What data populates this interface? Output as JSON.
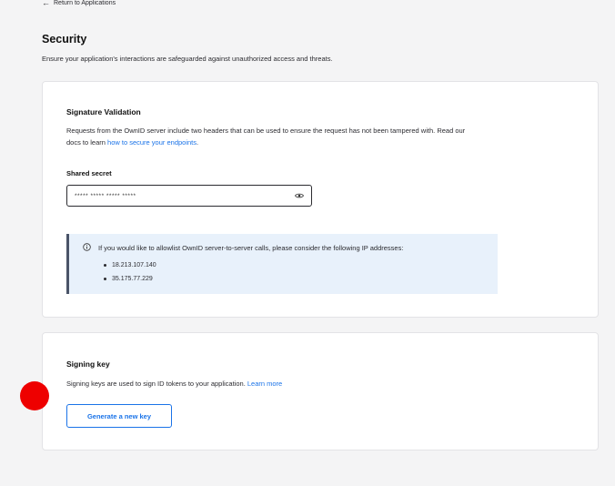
{
  "nav": {
    "back_label": "Return to Applications"
  },
  "header": {
    "title": "Security",
    "subtitle": "Ensure your application's interactions are safeguarded against unauthorized access and threats."
  },
  "signature": {
    "title": "Signature Validation",
    "desc_line1": "Requests from the OwnID server include two headers that can be used to ensure the request has not been tampered with. Read our",
    "desc_line2_prefix": "docs to learn ",
    "desc_link": "how to secure your endpoints",
    "desc_line2_suffix": ".",
    "secret_label": "Shared secret",
    "secret_value": "***** ***** ***** *****",
    "info_text": "If you would like to allowlist OwnID server-to-server calls, please consider the following IP addresses:",
    "ips": [
      "18.213.107.140",
      "35.175.77.229"
    ]
  },
  "signing": {
    "title": "Signing key",
    "desc": "Signing keys are used to sign ID tokens to your application. ",
    "link": "Learn more",
    "button_label": "Generate a new key"
  },
  "colors": {
    "accent": "#1a73e8",
    "info_bg": "#e8f1fb",
    "marker": "#ee0000"
  },
  "icons": [
    "left-arrow-icon",
    "eye-icon",
    "info-icon"
  ]
}
